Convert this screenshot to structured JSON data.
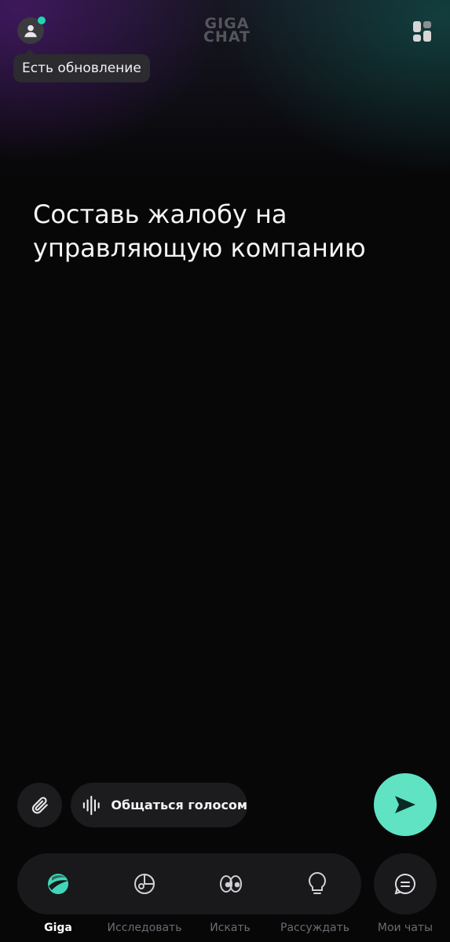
{
  "header": {
    "logo_line1": "GIGA",
    "logo_line2": "CHAT",
    "update_tooltip": "Есть обновление"
  },
  "prompt": {
    "line1": "Составь жалобу на",
    "line2": "управляющую компанию"
  },
  "input_bar": {
    "voice_label": "Общаться голосом"
  },
  "bottom_nav": {
    "items": [
      {
        "label": "Giga",
        "icon": "giga-logo-icon",
        "active": true
      },
      {
        "label": "Исследовать",
        "icon": "explore-icon",
        "active": false
      },
      {
        "label": "Искать",
        "icon": "eyes-icon",
        "active": false
      },
      {
        "label": "Рассуждать",
        "icon": "lightbulb-icon",
        "active": false
      },
      {
        "label": "Мои чаты",
        "icon": "chat-bubble-icon",
        "active": false
      }
    ]
  },
  "colors": {
    "accent": "#5fe3c3",
    "notification_dot": "#21d3b4",
    "background": "#070708",
    "surface": "#1c1c1f"
  }
}
